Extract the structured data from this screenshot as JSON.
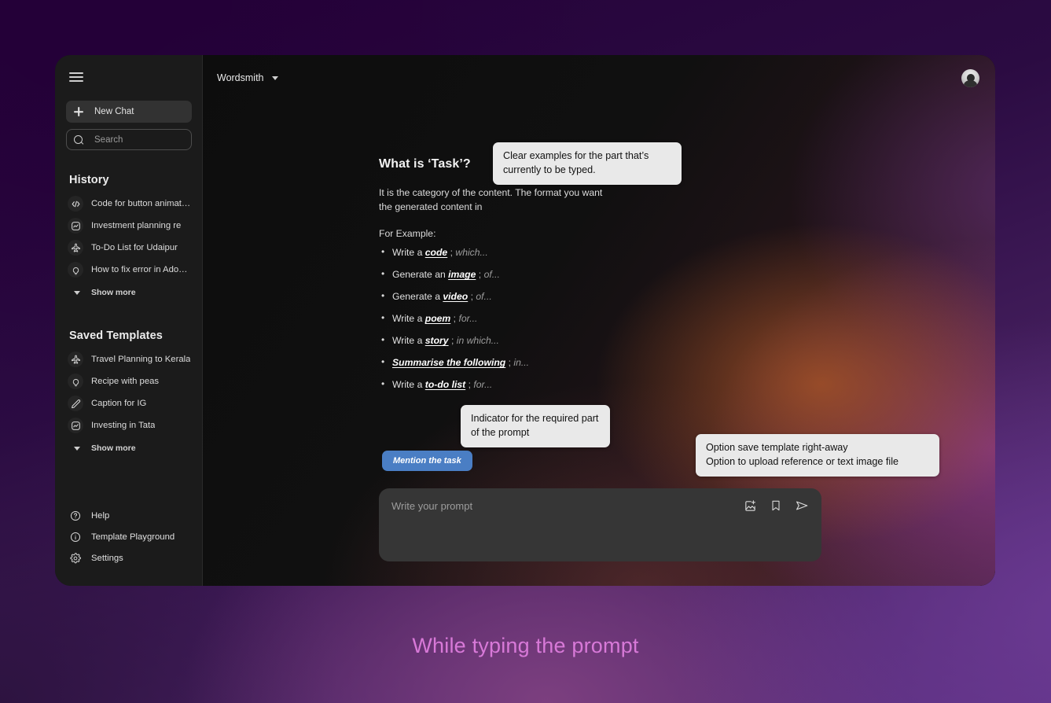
{
  "window": {
    "sidebar": {
      "menu_icon": "hamburger-icon",
      "new_chat": {
        "label": "New Chat",
        "icon": "plus-icon"
      },
      "search": {
        "placeholder": "Search",
        "icon": "search-icon"
      },
      "history": {
        "title": "History",
        "items": [
          {
            "label": "Code for button animation",
            "icon": "code-icon"
          },
          {
            "label": "Investment planning re",
            "icon": "chart-icon"
          },
          {
            "label": "To-Do List for Udaipur",
            "icon": "plane-icon"
          },
          {
            "label": "How to fix error in Adobe...",
            "icon": "lightbulb-icon"
          }
        ],
        "show_more": "Show more"
      },
      "saved_templates": {
        "title": "Saved Templates",
        "items": [
          {
            "label": "Travel Planning to Kerala",
            "icon": "plane-icon"
          },
          {
            "label": "Recipe with peas",
            "icon": "lightbulb-icon"
          },
          {
            "label": "Caption for IG",
            "icon": "pencil-icon"
          },
          {
            "label": "Investing in Tata",
            "icon": "chart-icon"
          }
        ],
        "show_more": "Show more"
      },
      "bottom_nav": [
        {
          "label": "Help",
          "icon": "question-circle-icon"
        },
        {
          "label": "Template Playground",
          "icon": "info-circle-icon"
        },
        {
          "label": "Settings",
          "icon": "gear-icon"
        }
      ]
    },
    "topbar": {
      "model_name": "Wordsmith",
      "dropdown_icon": "chevron-down-icon",
      "avatar": "user-avatar"
    },
    "content": {
      "heading": "What is ‘Task’?",
      "description": "It is the category of the content. The format you want the generated content in",
      "for_example_label": "For Example:",
      "examples": [
        {
          "prefix": "Write a ",
          "key": "code",
          "tail": "which..."
        },
        {
          "prefix": "Generate an ",
          "key": "image",
          "tail": "of..."
        },
        {
          "prefix": "Generate a ",
          "key": "video",
          "tail": "of..."
        },
        {
          "prefix": "Write a ",
          "key": "poem",
          "tail": "for..."
        },
        {
          "prefix": "Write a ",
          "key": "story",
          "tail": "in which..."
        },
        {
          "prefix": "",
          "key": "Summarise the following",
          "tail": "in..."
        },
        {
          "prefix": "Write a ",
          "key": "to-do list",
          "tail": "for..."
        }
      ],
      "separator": ";"
    },
    "mention_badge": "Mention the task",
    "composer": {
      "placeholder": "Write your prompt",
      "actions": [
        {
          "name": "add-image-icon"
        },
        {
          "name": "bookmark-icon"
        },
        {
          "name": "send-icon"
        }
      ]
    }
  },
  "annotations": {
    "examples": "Clear examples for the part that’s currently to be typed.",
    "indicator": "Indicator for the required part of the prompt",
    "options": "Option save template right-away\nOption to upload reference or text image file"
  },
  "caption": "While typing the prompt",
  "colors": {
    "accent_badge": "#4a7ec4",
    "caption": "#d879d8",
    "sidebar_bg": "#1b1b1b",
    "composer_bg": "#363636",
    "callout_bg": "#e9e9e9"
  }
}
